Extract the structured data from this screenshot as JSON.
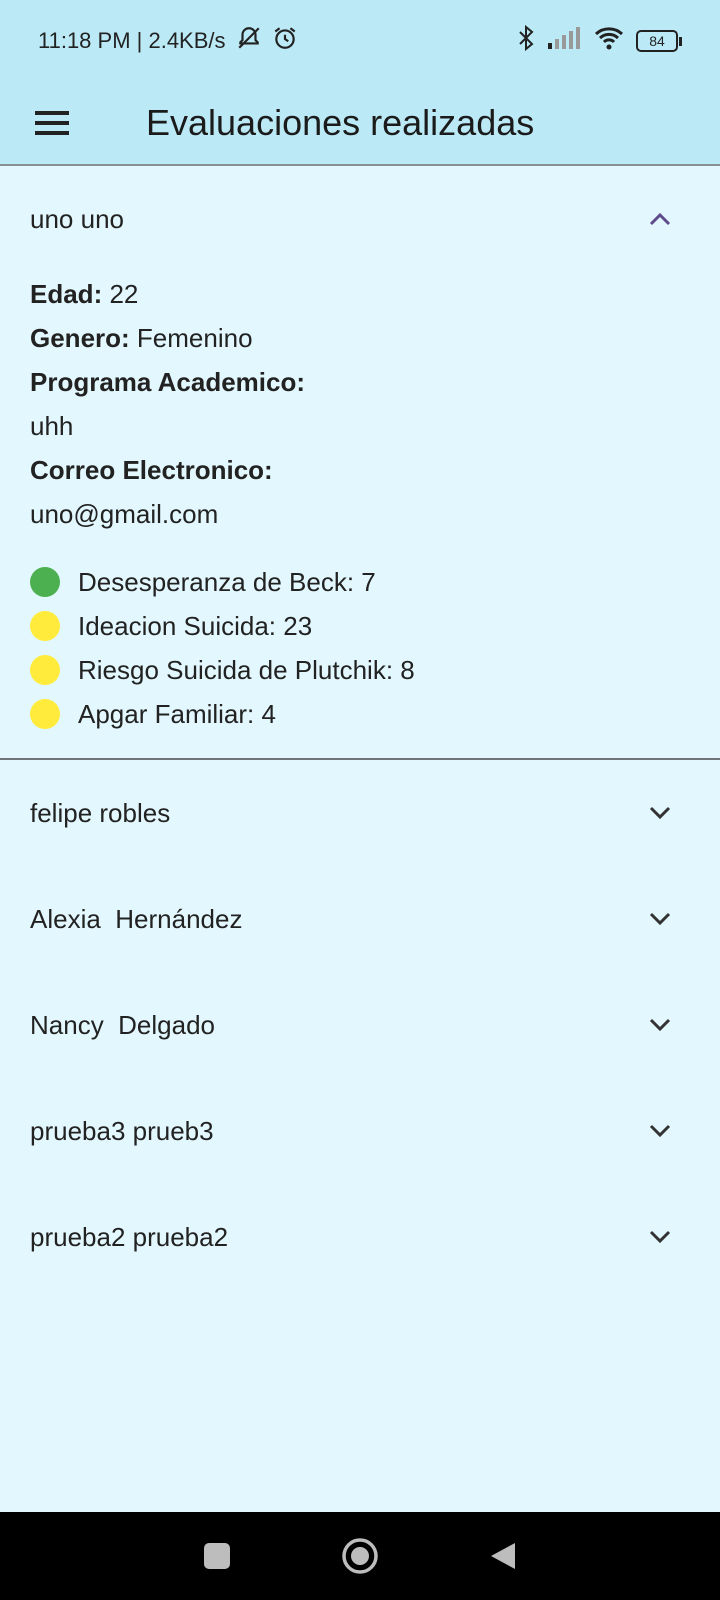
{
  "status_bar": {
    "time_speed": "11:18 PM | 2.4KB/s",
    "battery": "84"
  },
  "app_bar": {
    "title": "Evaluaciones realizadas",
    "menu_icon": "menu-icon"
  },
  "expanded_item": {
    "name": "uno uno",
    "age_label": "Edad:",
    "age": "22",
    "gender_label": "Genero:",
    "gender": "Femenino",
    "program_label": "Programa Academico:",
    "program": "uhh",
    "email_label": "Correo Electronico:",
    "email": "uno@gmail.com",
    "scores": [
      {
        "text": "Desesperanza de Beck: 7",
        "color": "#4caf50"
      },
      {
        "text": "Ideacion Suicida: 23",
        "color": "#ffeb3b"
      },
      {
        "text": "Riesgo Suicida de Plutchik: 8",
        "color": "#ffeb3b"
      },
      {
        "text": "Apgar Familiar: 4",
        "color": "#ffeb3b"
      }
    ]
  },
  "collapsed_items": [
    {
      "name": "felipe robles"
    },
    {
      "name": "Alexia  Hernández"
    },
    {
      "name": "Nancy  Delgado"
    },
    {
      "name": "prueba3 prueb3"
    },
    {
      "name": "prueba2 prueba2"
    }
  ],
  "colors": {
    "accent": "#5e4b8b",
    "appbar": "#bbeaf6",
    "background": "#e3f8fe"
  }
}
